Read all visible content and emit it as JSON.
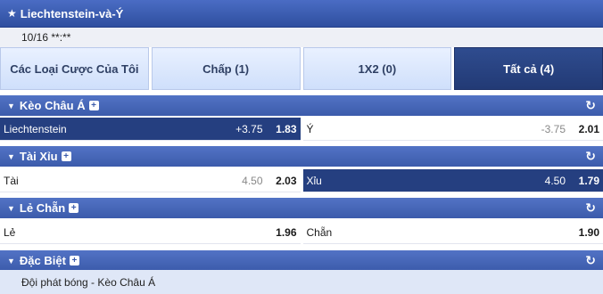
{
  "title": "Liechtenstein-và-Ý",
  "date": "10/16 **:**",
  "tabs": [
    "Các Loại Cược Của Tôi",
    "Chấp (1)",
    "1X2 (0)",
    "Tất cả (4)"
  ],
  "sections": [
    {
      "name": "Kèo Châu Á",
      "left": {
        "name": "Liechtenstein",
        "hdp": "+3.75",
        "odds": "1.83"
      },
      "right": {
        "name": "Ý",
        "hdp": "-3.75",
        "odds": "2.01"
      }
    },
    {
      "name": "Tài Xỉu",
      "left": {
        "name": "Tài",
        "hdp": "4.50",
        "odds": "2.03"
      },
      "right": {
        "name": "Xỉu",
        "hdp": "4.50",
        "odds": "1.79"
      }
    },
    {
      "name": "Lẻ Chẵn",
      "left": {
        "name": "Lẻ",
        "hdp": "",
        "odds": "1.96"
      },
      "right": {
        "name": "Chẵn",
        "hdp": "",
        "odds": "1.90"
      }
    },
    {
      "name": "Đặc Biệt",
      "item": "Đội phát bóng - Kèo Châu Á"
    }
  ],
  "colors": {
    "header": "#3c5bab",
    "selected": "#253f80",
    "tab_bg": "#dbe7fc"
  },
  "icons": {
    "star": "star-icon",
    "refresh": "refresh-icon",
    "expand": "plus-box-icon",
    "collapse": "caret-down-icon"
  }
}
